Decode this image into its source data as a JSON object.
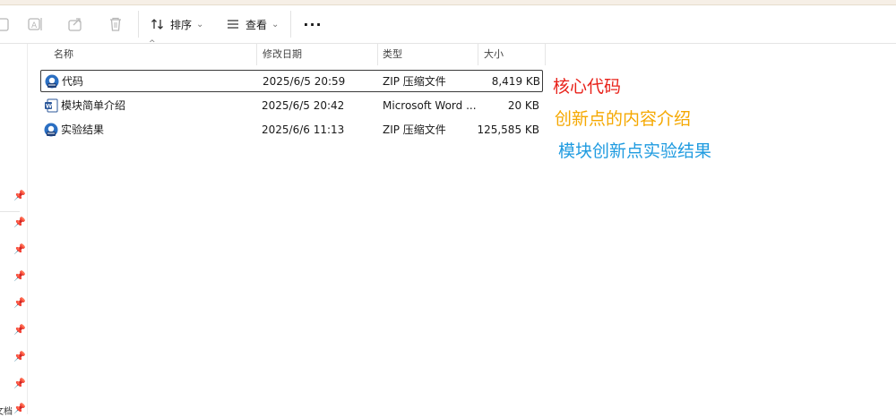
{
  "toolbar": {
    "sort_label": "排序",
    "view_label": "查看",
    "more_label": "···"
  },
  "columns": {
    "name": "名称",
    "modified": "修改日期",
    "type": "类型",
    "size": "大小"
  },
  "files": [
    {
      "name": "代码",
      "modified": "2025/6/5 20:59",
      "type": "ZIP 压缩文件",
      "size": "8,419 KB",
      "icon": "zip-archive-icon",
      "selected": true
    },
    {
      "name": "模块简单介绍",
      "modified": "2025/6/5 20:42",
      "type": "Microsoft Word ...",
      "size": "20 KB",
      "icon": "word-document-icon",
      "selected": false
    },
    {
      "name": "实验结果",
      "modified": "2025/6/6 11:13",
      "type": "ZIP 压缩文件",
      "size": "125,585 KB",
      "icon": "zip-archive-icon",
      "selected": false
    }
  ],
  "annotations": [
    {
      "text": "核心代码",
      "color": "#e8231b"
    },
    {
      "text": "创新点的内容介绍",
      "color": "#f5a800"
    },
    {
      "text": "模块创新点实验结果",
      "color": "#1f9be0"
    }
  ],
  "leftnav": {
    "partial_label": "文档"
  },
  "colors": {
    "zip_icon_blue": "#2b6fc2",
    "word_icon_blue": "#2b579a"
  }
}
